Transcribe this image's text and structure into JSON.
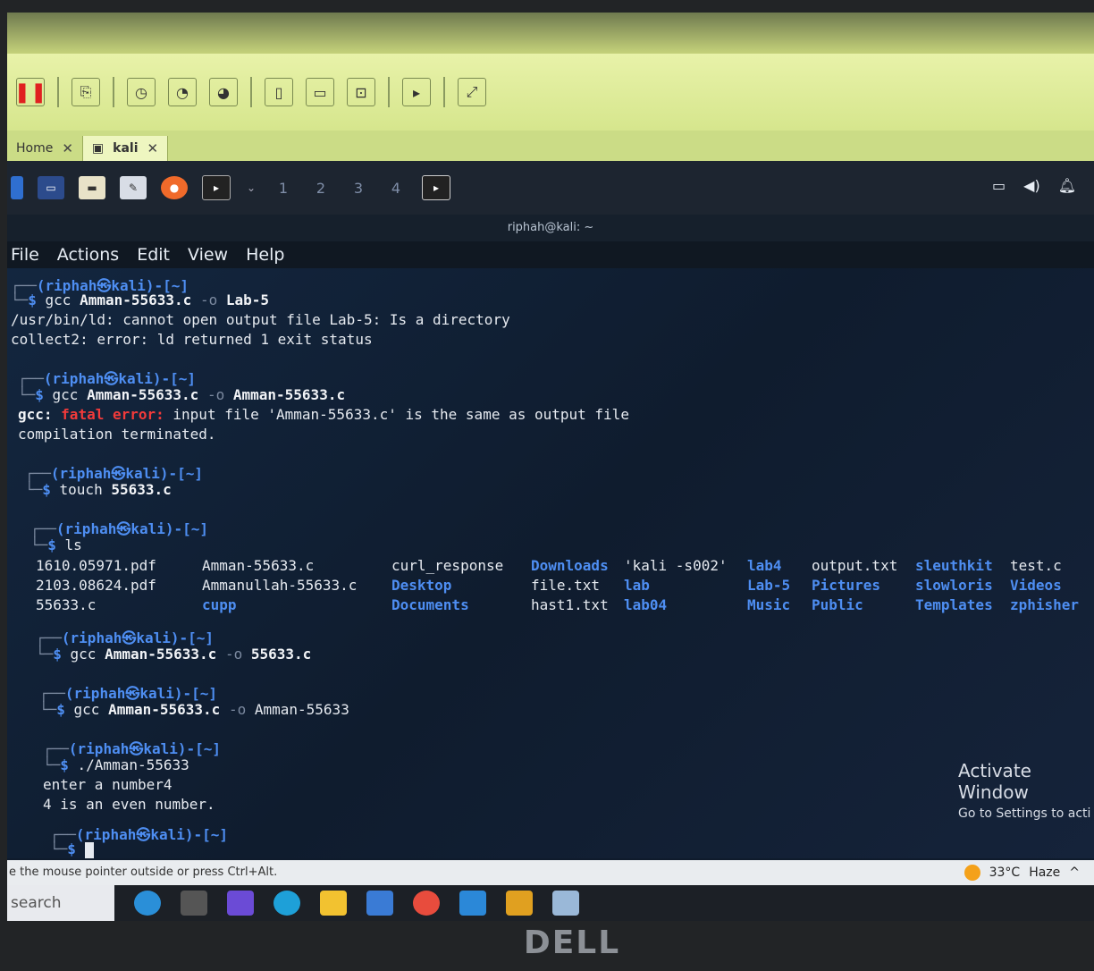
{
  "vm_tabs": [
    {
      "label": "Home",
      "active": false
    },
    {
      "label": "kali",
      "active": true
    }
  ],
  "toolbar_icons": [
    "pause-icon",
    "send-keys-icon",
    "snapshot-icon",
    "revert-snapshot-icon",
    "manage-snapshots-icon",
    "full-screen-icon",
    "unity-icon",
    "console-icon",
    "stretch-icon"
  ],
  "kali_panel": {
    "workspaces": [
      "1",
      "2",
      "3",
      "4"
    ],
    "icons": [
      "kali-menu-icon",
      "desktop-icon",
      "file-manager-icon",
      "text-editor-icon",
      "firefox-icon",
      "terminal-icon",
      "chevron-down-icon"
    ],
    "tray_icons": [
      "screen-icon",
      "volume-icon",
      "notification-bell-icon"
    ]
  },
  "terminal": {
    "title": "riphah@kali: ~",
    "menu": [
      "File",
      "Actions",
      "Edit",
      "View",
      "Help"
    ],
    "prompt_user": "(riphah㉿kali)-[~]",
    "lines": {
      "l1_cmd": "gcc",
      "l1_arg1": "Amman-55633.c",
      "l1_flag": "-o",
      "l1_arg2": "Lab-5",
      "l2": "/usr/bin/ld: cannot open output file Lab-5: Is a directory",
      "l3": "collect2: error: ld returned 1 exit status",
      "l4_cmd": "gcc",
      "l4_arg1": "Amman-55633.c",
      "l4_flag": "-o",
      "l4_arg2": "Amman-55633.c",
      "l5_prefix": "gcc:",
      "l5_error": "fatal error:",
      "l5_rest": "input file 'Amman-55633.c' is the same as output file",
      "l6": "compilation terminated.",
      "l7_cmd": "touch",
      "l7_arg": "55633.c",
      "l8_cmd": "ls",
      "l9_cmd": "gcc",
      "l9_arg1": "Amman-55633.c",
      "l9_flag": "-o",
      "l9_arg2": "55633.c",
      "l10_cmd": "gcc",
      "l10_arg1": "Amman-55633.c",
      "l10_flag": "-o",
      "l10_arg2": "Amman-55633",
      "l11_cmd": "./Amman-55633",
      "l12": "enter a number4",
      "l13": "4 is an even number."
    },
    "ls_columns": [
      [
        "1610.05971.pdf",
        "2103.08624.pdf",
        "55633.c"
      ],
      [
        "Amman-55633.c",
        "Ammanullah-55633.c",
        "cupp"
      ],
      [
        "curl_response",
        "Desktop",
        "Documents"
      ],
      [
        "Downloads",
        "file.txt",
        "hast1.txt"
      ],
      [
        "'kali -s002'",
        "lab",
        "lab04"
      ],
      [
        "lab4",
        "Lab-5",
        "Music"
      ],
      [
        "output.txt",
        "Pictures",
        "Public"
      ],
      [
        "sleuthkit",
        "slowloris",
        "Templates"
      ],
      [
        "test.c",
        "Videos",
        "zphisher"
      ]
    ],
    "ls_dirs": [
      "cupp",
      "Desktop",
      "Documents",
      "Downloads",
      "lab",
      "lab04",
      "lab4",
      "Lab-5",
      "Music",
      "Pictures",
      "Public",
      "sleuthkit",
      "slowloris",
      "Templates",
      "Videos",
      "zphisher"
    ]
  },
  "activate_windows": {
    "title": "Activate Window",
    "subtitle": "Go to Settings to acti"
  },
  "hint_bar": "e the mouse pointer outside or press Ctrl+Alt.",
  "weather": {
    "temp": "33°C",
    "condition": "Haze"
  },
  "win_search": "search",
  "brand": "DELL",
  "colors": {
    "prompt_blue": "#4e8ef2",
    "error_red": "#f23a3a",
    "vm_toolbar": "#d6e68d"
  }
}
